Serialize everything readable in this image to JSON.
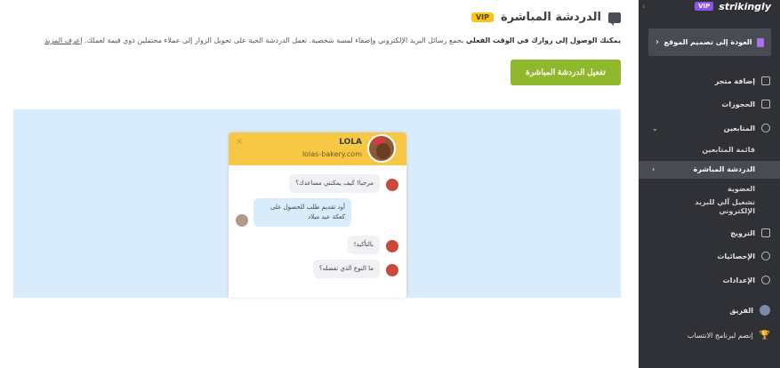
{
  "page": {
    "title": "الدردشة المباشرة",
    "vip_badge": "VIP",
    "description_bold": "يمكنك الوصول إلى زوارك في الوقت الفعلي",
    "description_rest": " بجمع رسائل البريد الإلكتروني وإضفاء لمسة شخصية. تعمل الدردشة الحية على تحويل الزوار إلى عملاء محتملين ذوي قيمة لعملك. ",
    "learn_more": "إعرف المزيد",
    "activate_button": "تفعيل الدردشة المباشرة"
  },
  "widget": {
    "close": "×",
    "name": "LOLA",
    "url": "lolas-bakery.com",
    "messages": [
      {
        "from": "agent",
        "text": "مرحبا! كيف يمكنني مساعدك؟"
      },
      {
        "from": "user",
        "text": "أود تقديم طلب للحصول على كعكة عيد ميلاد"
      },
      {
        "from": "agent",
        "text": "بالتأكيد!"
      },
      {
        "from": "agent",
        "text": "ما النوع الذي تفضله؟"
      }
    ]
  },
  "sidebar": {
    "collapse_icon": "‹",
    "brand": "strikingly",
    "brand_vip": "VIP",
    "back_label": "العودة إلى تصميم الموقع",
    "back_arrow": "‹",
    "items": {
      "add_store": "إضافة متجر",
      "bookings": "الحجوزات",
      "followers": "المتابعين",
      "followers_list": "قائمة المتابعين",
      "live_chat": "الدردشة المباشرة",
      "membership": "العضوية",
      "email_automation": "تشغيل آلي للبريد الإلكتروني",
      "promotion": "الترويج",
      "statistics": "الإحصائيات",
      "settings": "الإعدادات",
      "team": "الفريق",
      "affiliate": "إنضم لبرنامج الانتساب"
    },
    "chevron_down": "⌄",
    "chevron_left": "‹"
  },
  "colors": {
    "sidebar_bg": "#2f3136",
    "accent_green": "#8fb82c",
    "vip_yellow": "#f5c518",
    "vip_purple": "#8e53e8",
    "preview_bg": "#d9ecfb",
    "widget_header": "#f6c844"
  }
}
